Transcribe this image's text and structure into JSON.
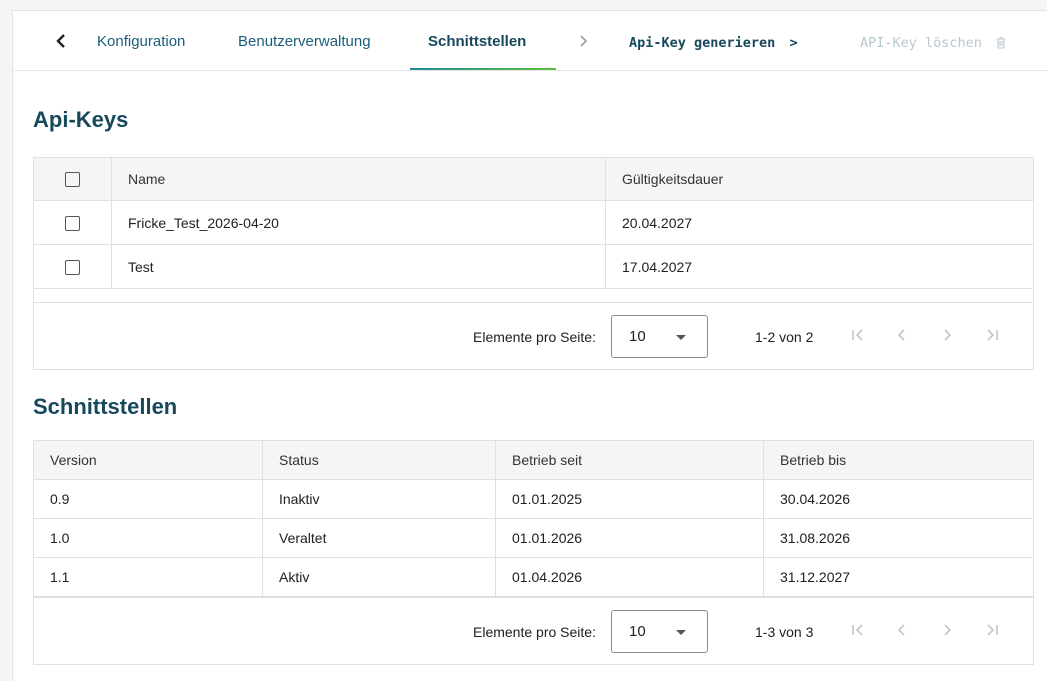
{
  "tabs": {
    "items": [
      {
        "label": "Konfiguration",
        "active": false
      },
      {
        "label": "Benutzerverwaltung",
        "active": false
      },
      {
        "label": "Schnittstellen",
        "active": true
      }
    ],
    "generate_label": "Api-Key generieren",
    "delete_label": "API-Key löschen"
  },
  "apikeys": {
    "title": "Api-Keys",
    "columns": [
      "Name",
      "Gültigkeitsdauer"
    ],
    "rows": [
      {
        "name": "Fricke_Test_2026-04-20",
        "validity": "20.04.2027"
      },
      {
        "name": "Test",
        "validity": "17.04.2027"
      }
    ],
    "pager": {
      "label": "Elemente pro Seite:",
      "page_size": "10",
      "range": "1-2 von 2"
    }
  },
  "interfaces": {
    "title": "Schnittstellen",
    "columns": [
      "Version",
      "Status",
      "Betrieb seit",
      "Betrieb bis"
    ],
    "rows": [
      {
        "version": "0.9",
        "status": "Inaktiv",
        "since": "01.01.2025",
        "until": "30.04.2026"
      },
      {
        "version": "1.0",
        "status": "Veraltet",
        "since": "01.01.2026",
        "until": "31.08.2026"
      },
      {
        "version": "1.1",
        "status": "Aktiv",
        "since": "01.04.2026",
        "until": "31.12.2027"
      }
    ],
    "pager": {
      "label": "Elemente pro Seite:",
      "page_size": "10",
      "range": "1-3 von 3"
    }
  },
  "colors": {
    "primary": "#17485c",
    "link": "#1a5e7a",
    "accent_start": "#1d8a9b",
    "accent_end": "#5fbf3a",
    "disabled": "#b9c7cf"
  },
  "icons": [
    "chevron-left-icon",
    "chevron-right-icon",
    "trash-icon",
    "first-page-icon",
    "last-page-icon",
    "dropdown-caret-icon"
  ]
}
